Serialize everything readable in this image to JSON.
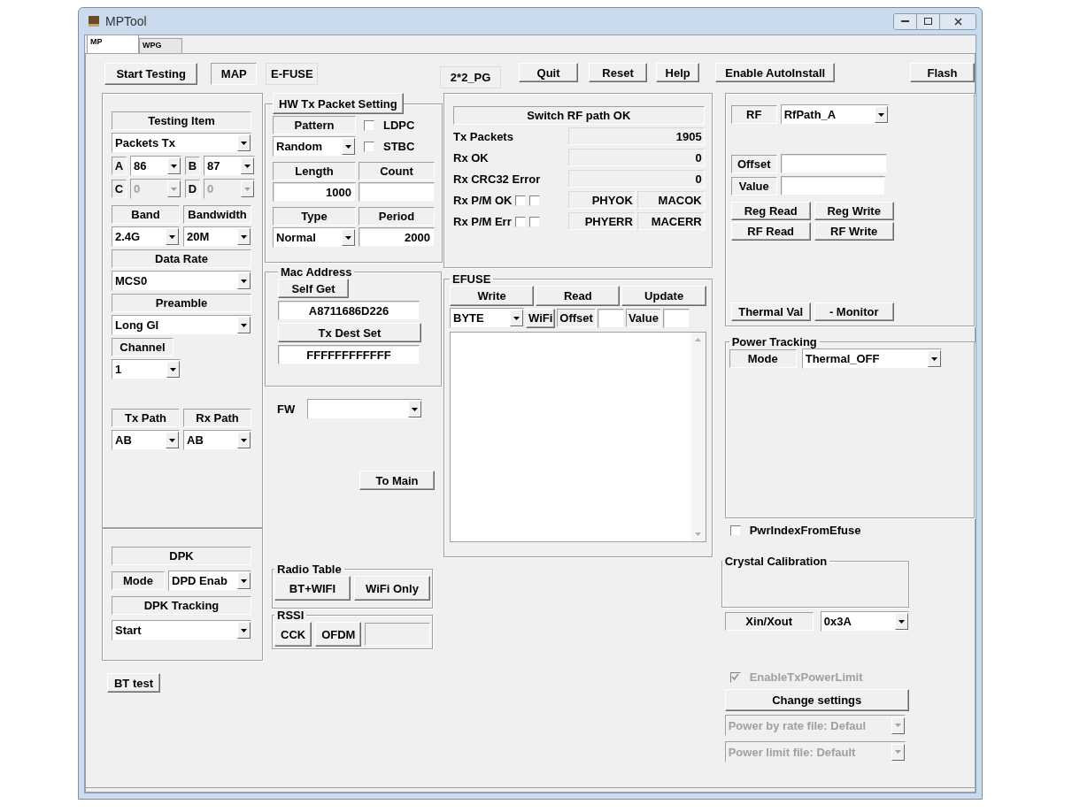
{
  "window": {
    "title": "MPTool"
  },
  "tabs": [
    {
      "label": "MP",
      "selected": true
    },
    {
      "label": "WPG",
      "selected": false
    }
  ],
  "toolbar": [
    {
      "label": "Start Testing",
      "kind": "button"
    },
    {
      "label": "MAP",
      "kind": "static"
    },
    {
      "label": "E-FUSE",
      "kind": "flat"
    },
    {
      "label": "2*2_PG",
      "kind": "flat"
    },
    {
      "label": "Quit",
      "kind": "button"
    },
    {
      "label": "Reset",
      "kind": "button"
    },
    {
      "label": "Help",
      "kind": "button"
    },
    {
      "label": "Enable AutoInstall",
      "kind": "button"
    },
    {
      "label": "Flash",
      "kind": "button"
    }
  ],
  "testing": {
    "testing_item_label": "Testing Item",
    "testing_item": "Packets Tx",
    "antennas": [
      {
        "label": "A",
        "value": "86",
        "disabled": false
      },
      {
        "label": "B",
        "value": "87",
        "disabled": false
      },
      {
        "label": "C",
        "value": "0",
        "disabled": true
      },
      {
        "label": "D",
        "value": "0",
        "disabled": true
      }
    ],
    "band_label": "Band",
    "band": "2.4G",
    "bandwidth_label": "Bandwidth",
    "bandwidth": "20M",
    "data_rate_label": "Data Rate",
    "data_rate": "MCS0",
    "preamble_label": "Preamble",
    "preamble": "Long GI",
    "channel_label": "Channel",
    "channel": "1",
    "tx_path_label": "Tx Path",
    "tx_path": "AB",
    "rx_path_label": "Rx Path",
    "rx_path": "AB"
  },
  "dpk": {
    "title": "DPK",
    "mode_label": "Mode",
    "mode": "DPD Enab",
    "tracking_label": "DPK Tracking",
    "tracking": "Start"
  },
  "bt_test": "BT test",
  "hw_tx": {
    "title": "HW Tx Packet Setting",
    "pattern_label": "Pattern",
    "pattern": "Random",
    "options": [
      {
        "label": "LDPC",
        "checked": false
      },
      {
        "label": "STBC",
        "checked": false
      }
    ],
    "length_label": "Length",
    "length": "1000",
    "count_label": "Count",
    "type_label": "Type",
    "type": "Normal",
    "period_label": "Period",
    "period": "2000"
  },
  "mac": {
    "title": "Mac Address",
    "self_get": "Self Get",
    "address": "A8711686D226",
    "tx_dest_set": "Tx Dest Set",
    "dest": "FFFFFFFFFFFF"
  },
  "fw": {
    "label": "FW"
  },
  "to_main": "To Main",
  "radio_table": {
    "title": "Radio Table",
    "buttons": [
      "BT+WIFI",
      "WiFi Only"
    ]
  },
  "rssi": {
    "title": "RSSI",
    "buttons": [
      "CCK",
      "OFDM"
    ]
  },
  "status": {
    "message": "Switch RF path OK",
    "rows": [
      {
        "label": "Tx Packets",
        "value": "1905"
      },
      {
        "label": "Rx OK",
        "value": "0"
      },
      {
        "label": "Rx CRC32 Error",
        "value": "0"
      }
    ],
    "pm_rows": [
      {
        "label": "Rx P/M OK",
        "checks": [
          {
            "checked": false
          },
          {
            "checked": false
          }
        ],
        "phy": "PHYOK",
        "mac": "MACOK"
      },
      {
        "label": "Rx P/M Err",
        "checks": [
          {
            "checked": false
          },
          {
            "checked": false
          }
        ],
        "phy": "PHYERR",
        "mac": "MACERR"
      }
    ]
  },
  "efuse": {
    "title": "EFUSE",
    "buttons": [
      "Write",
      "Read",
      "Update"
    ],
    "mode": "BYTE",
    "wifi": "WiFi",
    "offset_label": "Offset",
    "value_label": "Value"
  },
  "rf": {
    "label": "RF",
    "path": "RfPath_A",
    "offset_label": "Offset",
    "value_label": "Value",
    "buttons": [
      "Reg Read",
      "Reg Write",
      "RF Read",
      "RF Write"
    ],
    "thermal": [
      "Thermal Val",
      "- Monitor"
    ]
  },
  "power_tracking": {
    "title": "Power Tracking",
    "mode_label": "Mode",
    "mode": "Thermal_OFF"
  },
  "pwr_index": {
    "label": "PwrIndexFromEfuse",
    "checked": false
  },
  "crystal": {
    "title": "Crystal Calibration",
    "xin_label": "Xin/Xout",
    "xin": "0x3A"
  },
  "tx_power_limit": {
    "label": "EnableTxPowerLimit",
    "checked": true,
    "disabled": true
  },
  "change_settings": "Change settings",
  "files": [
    {
      "value": "Power by rate file: Defaul",
      "disabled": true
    },
    {
      "value": "Power limit file: Default",
      "disabled": true
    }
  ]
}
